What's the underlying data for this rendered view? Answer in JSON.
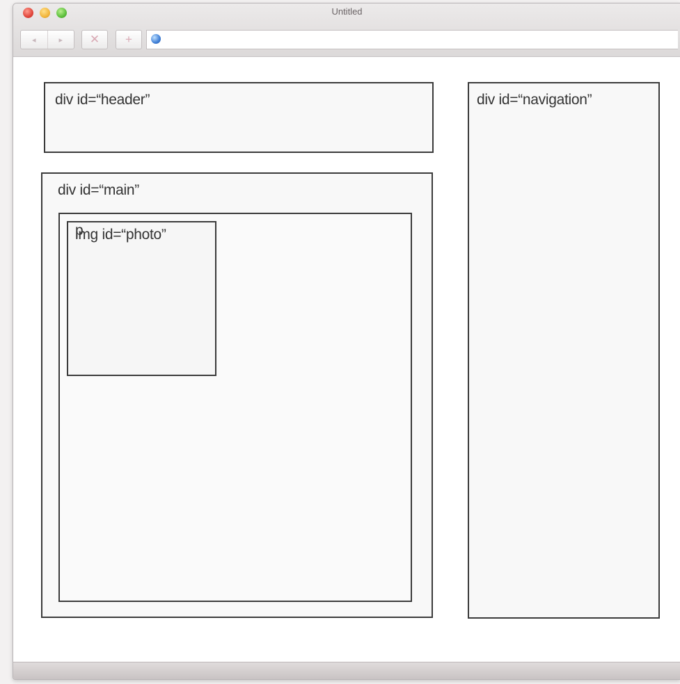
{
  "window": {
    "title": "Untitled"
  },
  "toolbar": {
    "back_icon": "◂",
    "forward_icon": "▸",
    "stop_icon": "✕",
    "add_icon": "+",
    "address_value": ""
  },
  "diagram": {
    "header_label": "div id=“header”",
    "navigation_label": "div id=“navigation”",
    "main_label": "div id=“main”",
    "photo_label": "img id=“photo”",
    "paragraph_label": "p"
  },
  "colors": {
    "box_border": "#3a3a3a",
    "box_fill": "#f8f8f8",
    "titlebar": "#dcd9d9"
  }
}
